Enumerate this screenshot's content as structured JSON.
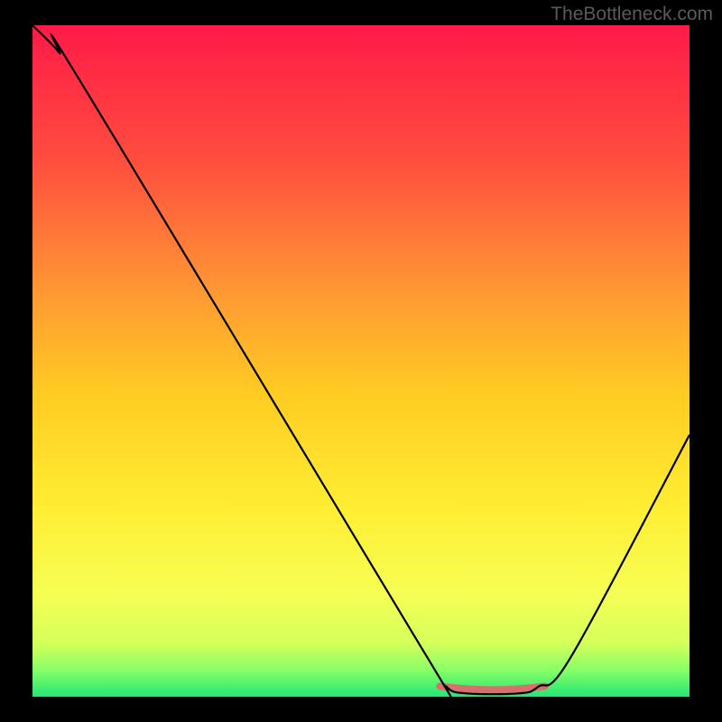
{
  "attribution": "TheBottleneck.com",
  "chart_data": {
    "type": "line",
    "title": "",
    "xlabel": "",
    "ylabel": "",
    "xlim": [
      0,
      100
    ],
    "ylim": [
      0,
      100
    ],
    "gradient_stops": [
      {
        "offset": 0,
        "color": "#ff1a48"
      },
      {
        "offset": 20,
        "color": "#ff4d3e"
      },
      {
        "offset": 40,
        "color": "#ff9933"
      },
      {
        "offset": 55,
        "color": "#ffcc22"
      },
      {
        "offset": 72,
        "color": "#ffee33"
      },
      {
        "offset": 85,
        "color": "#f5ff55"
      },
      {
        "offset": 92,
        "color": "#d5ff5a"
      },
      {
        "offset": 96,
        "color": "#88ff66"
      },
      {
        "offset": 100,
        "color": "#22e676"
      }
    ],
    "curve": [
      {
        "x": 0,
        "y": 100
      },
      {
        "x": 4,
        "y": 96
      },
      {
        "x": 8,
        "y": 90.5
      },
      {
        "x": 60,
        "y": 6
      },
      {
        "x": 63,
        "y": 1.5
      },
      {
        "x": 66,
        "y": 0.5
      },
      {
        "x": 74,
        "y": 0.5
      },
      {
        "x": 77,
        "y": 1.5
      },
      {
        "x": 82,
        "y": 6
      },
      {
        "x": 100,
        "y": 39
      }
    ],
    "marker_band": {
      "x_start": 62,
      "x_end": 78,
      "y": 1.3,
      "color": "#d6706b",
      "width": 8
    }
  }
}
